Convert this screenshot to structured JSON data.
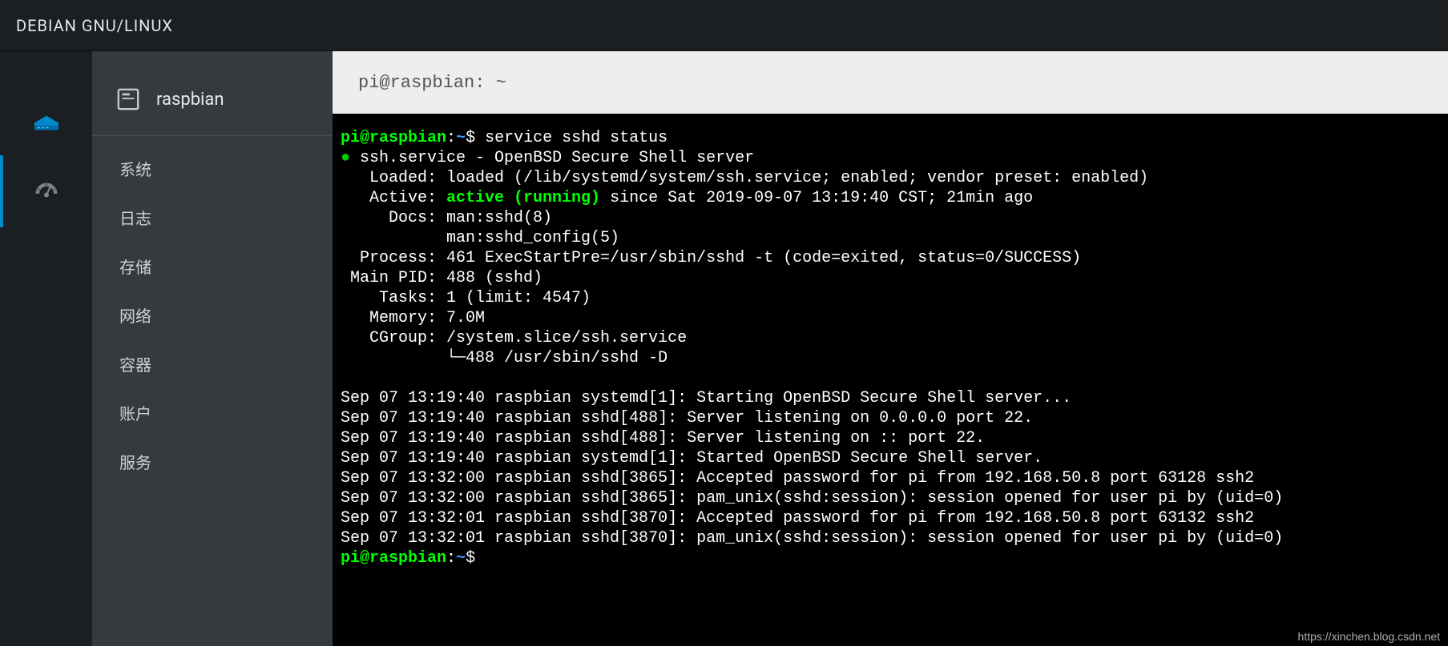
{
  "topbar": {
    "title": "DEBIAN GNU/LINUX"
  },
  "sidebar": {
    "hostname": "raspbian",
    "items": [
      {
        "label": "系统"
      },
      {
        "label": "日志"
      },
      {
        "label": "存储"
      },
      {
        "label": "网络"
      },
      {
        "label": "容器"
      },
      {
        "label": "账户"
      },
      {
        "label": "服务"
      }
    ]
  },
  "titlebar": {
    "text": "pi@raspbian: ~"
  },
  "terminal": {
    "prompt_user": "pi@raspbian",
    "prompt_sep": ":",
    "prompt_path": "~",
    "prompt_end": "$ ",
    "command": "service sshd status",
    "status": {
      "bullet": "●",
      "service_line": "ssh.service - OpenBSD Secure Shell server",
      "loaded": "   Loaded: loaded (/lib/systemd/system/ssh.service; enabled; vendor preset: enabled)",
      "active_label": "   Active: ",
      "active_value": "active (running)",
      "active_rest": " since Sat 2019-09-07 13:19:40 CST; 21min ago",
      "docs1": "     Docs: man:sshd(8)",
      "docs2": "           man:sshd_config(5)",
      "process": "  Process: 461 ExecStartPre=/usr/sbin/sshd -t (code=exited, status=0/SUCCESS)",
      "mainpid": " Main PID: 488 (sshd)",
      "tasks": "    Tasks: 1 (limit: 4547)",
      "memory": "   Memory: 7.0M",
      "cgroup": "   CGroup: /system.slice/ssh.service",
      "cgroup2": "           └─488 /usr/sbin/sshd -D"
    },
    "logs": [
      "Sep 07 13:19:40 raspbian systemd[1]: Starting OpenBSD Secure Shell server...",
      "Sep 07 13:19:40 raspbian sshd[488]: Server listening on 0.0.0.0 port 22.",
      "Sep 07 13:19:40 raspbian sshd[488]: Server listening on :: port 22.",
      "Sep 07 13:19:40 raspbian systemd[1]: Started OpenBSD Secure Shell server.",
      "Sep 07 13:32:00 raspbian sshd[3865]: Accepted password for pi from 192.168.50.8 port 63128 ssh2",
      "Sep 07 13:32:00 raspbian sshd[3865]: pam_unix(sshd:session): session opened for user pi by (uid=0)",
      "Sep 07 13:32:01 raspbian sshd[3870]: Accepted password for pi from 192.168.50.8 port 63132 ssh2",
      "Sep 07 13:32:01 raspbian sshd[3870]: pam_unix(sshd:session): session opened for user pi by (uid=0)"
    ]
  },
  "watermark": "https://xinchen.blog.csdn.net"
}
